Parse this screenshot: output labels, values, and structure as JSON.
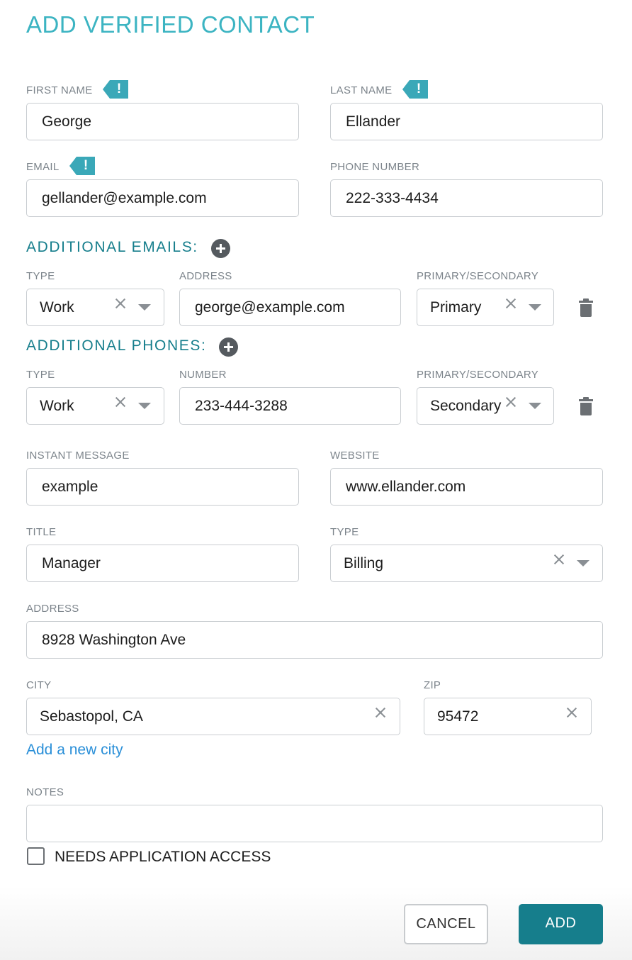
{
  "title": "ADD VERIFIED CONTACT",
  "first_name": {
    "label": "FIRST NAME",
    "value": "George",
    "badge": "!"
  },
  "last_name": {
    "label": "LAST NAME",
    "value": "Ellander",
    "badge": "!"
  },
  "email": {
    "label": "EMAIL",
    "value": "gellander@example.com",
    "badge": "!"
  },
  "phone": {
    "label": "PHONE NUMBER",
    "value": "222-333-4434"
  },
  "additional_emails": {
    "heading": "ADDITIONAL EMAILS:",
    "type_label": "TYPE",
    "address_label": "ADDRESS",
    "primary_label": "PRIMARY/SECONDARY",
    "row": {
      "type": "Work",
      "address": "george@example.com",
      "priority": "Primary"
    }
  },
  "additional_phones": {
    "heading": "ADDITIONAL PHONES:",
    "type_label": "TYPE",
    "number_label": "NUMBER",
    "primary_label": "PRIMARY/SECONDARY",
    "row": {
      "type": "Work",
      "number": "233-444-3288",
      "priority": "Secondary"
    }
  },
  "instant_message": {
    "label": "INSTANT MESSAGE",
    "value": "example"
  },
  "website": {
    "label": "WEBSITE",
    "value": "www.ellander.com"
  },
  "job_title": {
    "label": "TITLE",
    "value": "Manager"
  },
  "contact_type": {
    "label": "TYPE",
    "value": "Billing"
  },
  "address": {
    "label": "ADDRESS",
    "value": "8928 Washington Ave"
  },
  "city": {
    "label": "CITY",
    "value": "Sebastopol, CA"
  },
  "zip": {
    "label": "ZIP",
    "value": "95472"
  },
  "add_city_link": "Add a new city",
  "notes": {
    "label": "NOTES",
    "value": ""
  },
  "needs_access": {
    "label": "NEEDS APPLICATION ACCESS",
    "checked": false
  },
  "buttons": {
    "cancel": "CANCEL",
    "add": "ADD"
  },
  "icons": {
    "required": "exclamation-badge-icon",
    "add": "plus-circle-icon",
    "delete": "trash-icon",
    "clear": "close-icon",
    "dropdown": "caret-down-icon"
  },
  "colors": {
    "accent": "#3cb4c2",
    "primary": "#167e8c",
    "link": "#2a8fd8"
  }
}
